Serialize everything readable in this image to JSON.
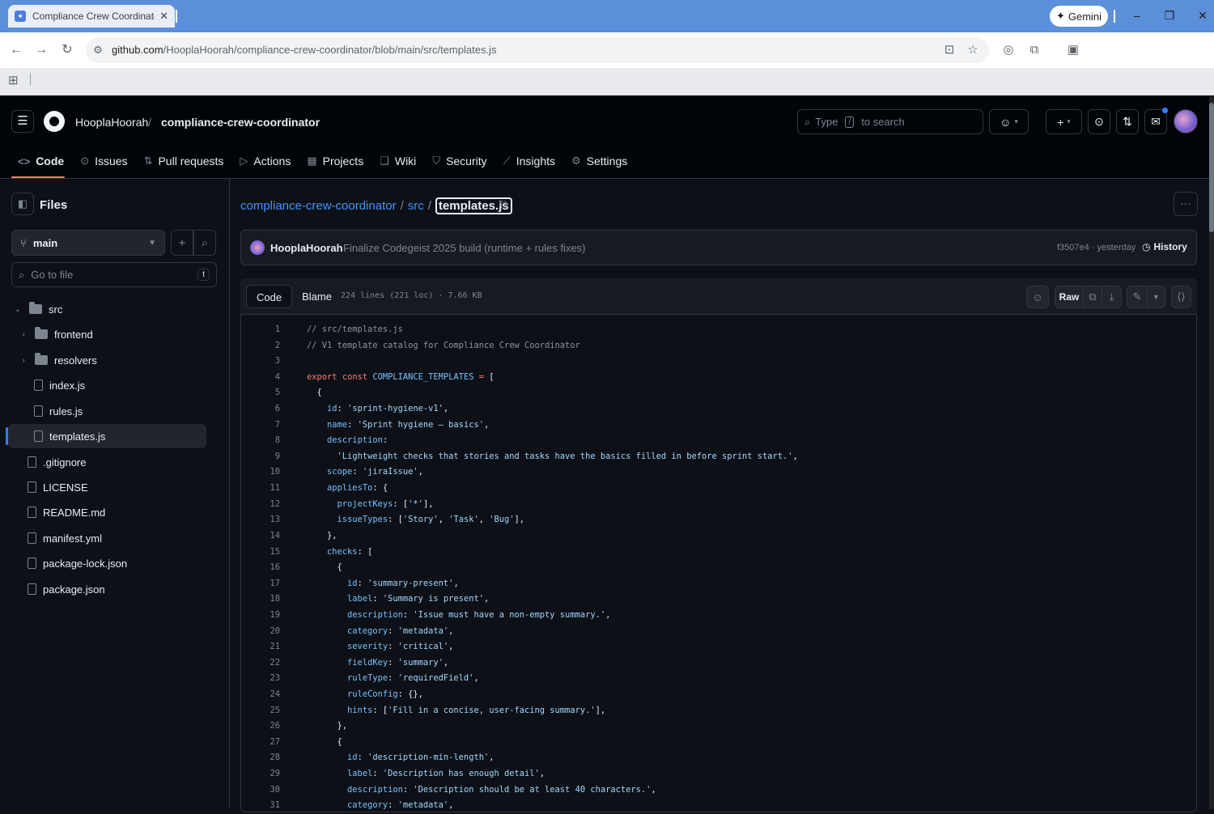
{
  "browser": {
    "tab_title": "Compliance Crew Coordinator",
    "tab_close": "✕",
    "gemini_label": "Gemini",
    "url_host": "github.com",
    "url_path": "/HooplaHoorah/compliance-crew-coordinator/blob/main/src/templates.js"
  },
  "header": {
    "owner": "HooplaHoorah",
    "separator": "/",
    "repo": "compliance-crew-coordinator",
    "search_prefix": "Type",
    "search_key": "/",
    "search_suffix": "to search"
  },
  "repo_nav": [
    {
      "label": "Code",
      "icon": "code-icon",
      "glyph": "<>"
    },
    {
      "label": "Issues",
      "icon": "issue-icon",
      "glyph": "⊙"
    },
    {
      "label": "Pull requests",
      "icon": "pull-request-icon",
      "glyph": "⇅"
    },
    {
      "label": "Actions",
      "icon": "play-icon",
      "glyph": "▷"
    },
    {
      "label": "Projects",
      "icon": "table-icon",
      "glyph": "▦"
    },
    {
      "label": "Wiki",
      "icon": "book-icon",
      "glyph": "❑"
    },
    {
      "label": "Security",
      "icon": "shield-icon",
      "glyph": "⛉"
    },
    {
      "label": "Insights",
      "icon": "graph-icon",
      "glyph": "⟋"
    },
    {
      "label": "Settings",
      "icon": "gear-icon",
      "glyph": "⚙"
    }
  ],
  "sidebar": {
    "title": "Files",
    "branch": "main",
    "goto_placeholder": "Go to file",
    "goto_key": "t",
    "tree": [
      {
        "name": "src",
        "type": "folder",
        "chev": "⌄",
        "indent": 0
      },
      {
        "name": "frontend",
        "type": "folder",
        "chev": "›",
        "indent": 1
      },
      {
        "name": "resolvers",
        "type": "folder",
        "chev": "›",
        "indent": 1
      },
      {
        "name": "index.js",
        "type": "file",
        "indent": 2
      },
      {
        "name": "rules.js",
        "type": "file",
        "indent": 2
      },
      {
        "name": "templates.js",
        "type": "file",
        "indent": 2
      },
      {
        "name": ".gitignore",
        "type": "file",
        "indent": 0
      },
      {
        "name": "LICENSE",
        "type": "file",
        "indent": 0
      },
      {
        "name": "README.md",
        "type": "file",
        "indent": 0
      },
      {
        "name": "manifest.yml",
        "type": "file",
        "indent": 0
      },
      {
        "name": "package-lock.json",
        "type": "file",
        "indent": 0
      },
      {
        "name": "package.json",
        "type": "file",
        "indent": 0
      }
    ]
  },
  "path": {
    "repo_link": "compliance-crew-coordinator",
    "dir_link": "src",
    "sep": "/",
    "current": "templates.js"
  },
  "commit": {
    "author": "HooplaHoorah",
    "message": "Finalize Codegeist 2025 build (runtime + rules fixes)",
    "meta": "f3507e4 · yesterday",
    "history_label": "History"
  },
  "file_header": {
    "code_tab": "Code",
    "blame_tab": "Blame",
    "info": "224 lines (221 loc) · 7.66 KB",
    "raw_label": "Raw"
  },
  "code_lines": [
    "// src/templates.js",
    "// V1 template catalog for Compliance Crew Coordinator",
    "",
    "export const COMPLIANCE_TEMPLATES = [",
    "  {",
    "    id: 'sprint-hygiene-v1',",
    "    name: 'Sprint hygiene – basics',",
    "    description:",
    "      'Lightweight checks that stories and tasks have the basics filled in before sprint start.',",
    "    scope: 'jiraIssue',",
    "    appliesTo: {",
    "      projectKeys: ['*'],",
    "      issueTypes: ['Story', 'Task', 'Bug'],",
    "    },",
    "    checks: [",
    "      {",
    "        id: 'summary-present',",
    "        label: 'Summary is present',",
    "        description: 'Issue must have a non-empty summary.',",
    "        category: 'metadata',",
    "        severity: 'critical',",
    "        fieldKey: 'summary',",
    "        ruleType: 'requiredField',",
    "        ruleConfig: {},",
    "        hints: ['Fill in a concise, user-facing summary.'],",
    "      },",
    "      {",
    "        id: 'description-min-length',",
    "        label: 'Description has enough detail',",
    "        description: 'Description should be at least 40 characters.',",
    "        category: 'metadata',"
  ]
}
